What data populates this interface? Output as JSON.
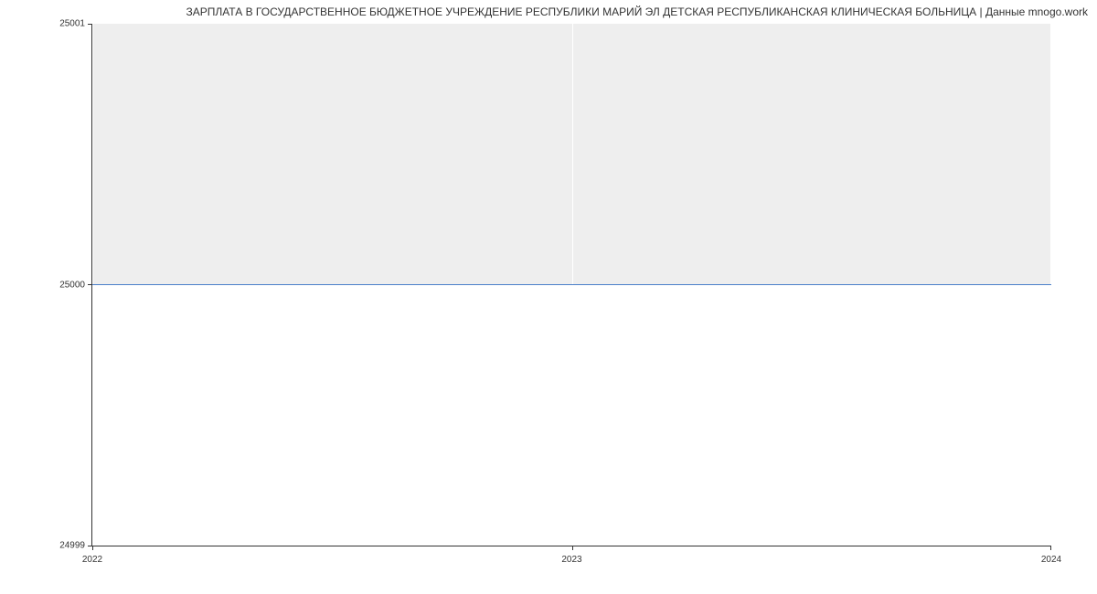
{
  "chart_data": {
    "type": "area",
    "title": "ЗАРПЛАТА В ГОСУДАРСТВЕННОЕ БЮДЖЕТНОЕ УЧРЕЖДЕНИЕ РЕСПУБЛИКИ МАРИЙ ЭЛ ДЕТСКАЯ РЕСПУБЛИКАНСКАЯ КЛИНИЧЕСКАЯ БОЛЬНИЦА | Данные mnogo.work",
    "x": [
      2022,
      2023,
      2024
    ],
    "values": [
      25000,
      25000,
      25000
    ],
    "x_ticks": [
      "2022",
      "2023",
      "2024"
    ],
    "y_ticks": [
      "24999",
      "25000",
      "25001"
    ],
    "xlabel": "",
    "ylabel": "",
    "xlim": [
      2022,
      2024
    ],
    "ylim": [
      24999,
      25001
    ],
    "line_color": "#4a7fc9",
    "fill_color": "#eeeeee"
  }
}
